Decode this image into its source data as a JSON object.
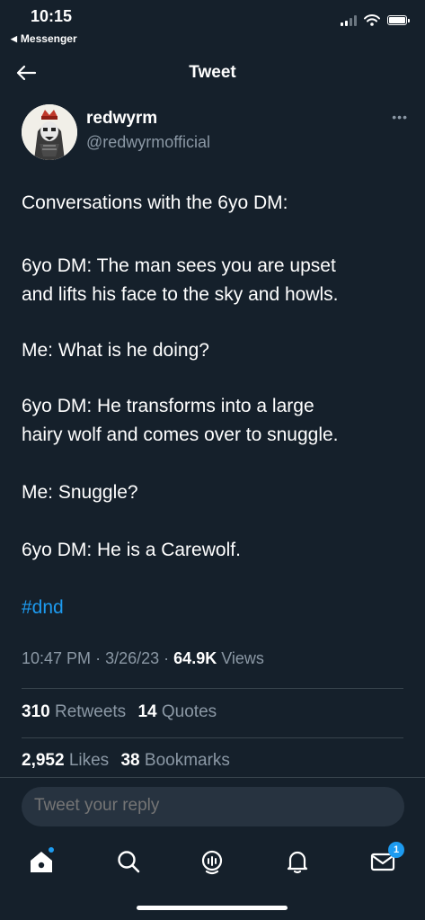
{
  "status_bar": {
    "time": "10:15",
    "back_app": "Messenger"
  },
  "header": {
    "title": "Tweet",
    "back_icon": "arrow-left-icon"
  },
  "author": {
    "display_name": "redwyrm",
    "handle": "@redwyrmofficial",
    "more_icon": "ellipsis-icon"
  },
  "tweet": {
    "paragraphs": [
      [
        "Conversations with the 6yo DM:"
      ],
      [
        "6yo DM: The man sees you are upset",
        "and lifts his face to the sky and howls."
      ],
      [
        "Me: What is he doing?"
      ],
      [
        "6yo DM: He transforms into a large",
        "hairy wolf and comes over to snuggle."
      ],
      [
        "Me: Snuggle?"
      ],
      [
        "6yo DM: He is a Carewolf."
      ],
      [
        "#dnd"
      ]
    ]
  },
  "meta": {
    "time": "10:47 PM",
    "separator": "·",
    "date": "3/26/23",
    "views_count": "64.9K",
    "views_label": "Views"
  },
  "stats": {
    "retweets_count": "310",
    "retweets_label": "Retweets",
    "quotes_count": "14",
    "quotes_label": "Quotes",
    "likes_count": "2,952",
    "likes_label": "Likes",
    "bookmarks_count": "38",
    "bookmarks_label": "Bookmarks"
  },
  "reply": {
    "placeholder": "Tweet your reply"
  },
  "tabbar": {
    "icons": [
      "home-icon",
      "search-icon",
      "spaces-icon",
      "notifications-icon",
      "messages-icon"
    ],
    "messages_badge": "1"
  },
  "colors": {
    "background": "#15202b",
    "accent": "#1d9bf0",
    "secondary_text": "#8b98a5",
    "divider": "#38444d"
  }
}
